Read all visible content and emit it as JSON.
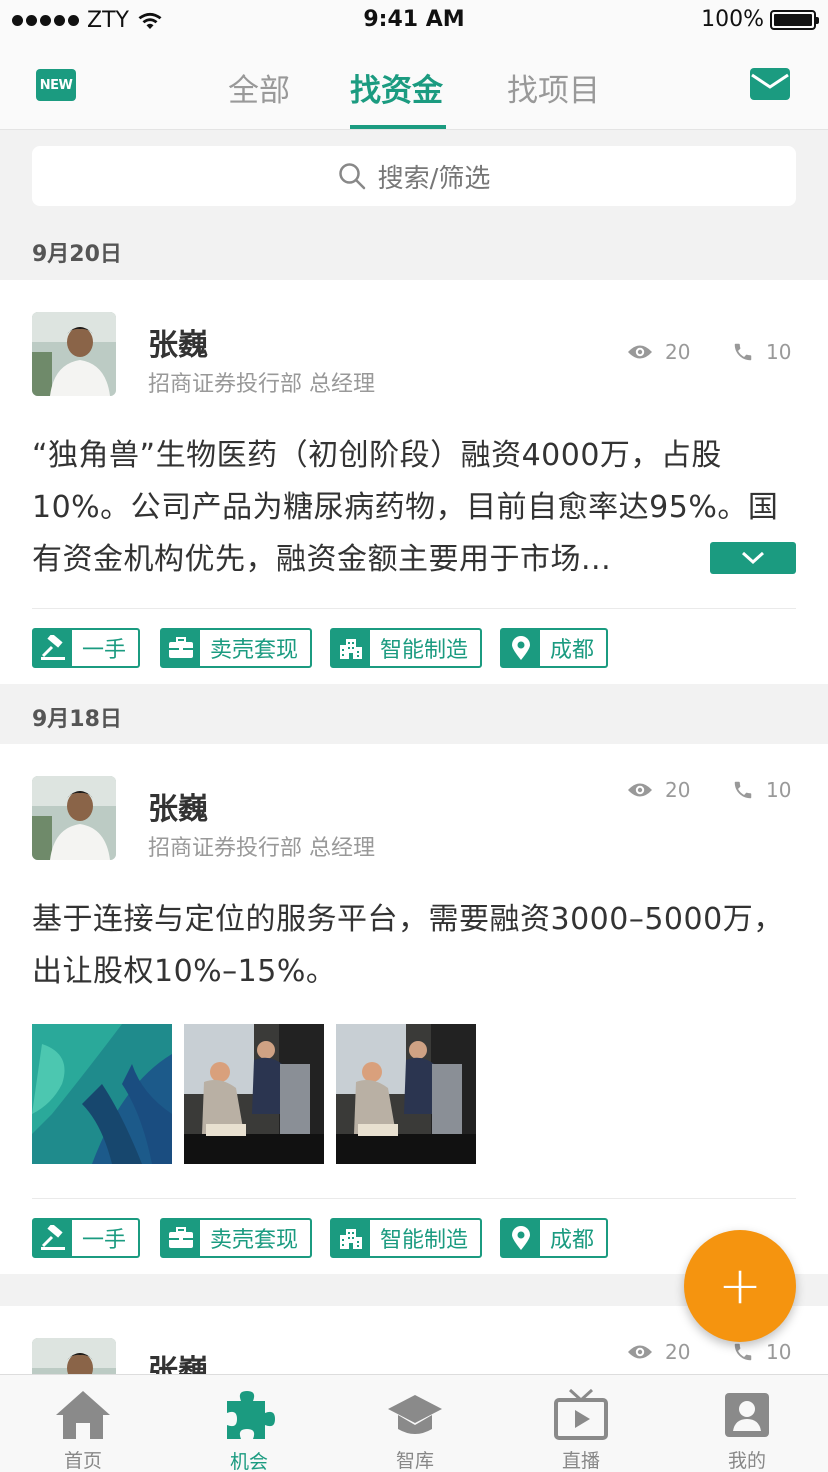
{
  "status_bar": {
    "carrier": "ZTY",
    "time": "9:41 AM",
    "battery": "100%"
  },
  "top_nav": {
    "new_badge": "NEW",
    "tabs": [
      {
        "label": "全部",
        "active": false
      },
      {
        "label": "找资金",
        "active": true
      },
      {
        "label": "找项目",
        "active": false
      }
    ],
    "mail_icon": "mail-icon"
  },
  "search": {
    "placeholder": "搜索/筛选"
  },
  "groups": [
    {
      "date": "9月20日",
      "post": {
        "name": "张巍",
        "subtitle": "招商证券投行部 总经理",
        "views": "20",
        "calls": "10",
        "text": "“独角兽”生物医药（初创阶段）融资4000万，占股10%。公司产品为糖尿病药物，目前自愈率达95%。国有资金机构优先，融资金额主要用于市场...",
        "tags": [
          "一手",
          "卖壳套现",
          "智能制造",
          "成都"
        ]
      }
    },
    {
      "date": "9月18日",
      "post": {
        "name": "张巍",
        "subtitle": "招商证券投行部 总经理",
        "views": "20",
        "calls": "10",
        "text": "基于连接与定位的服务平台，需要融资3000–5000万，出让股权10%–15%。",
        "tags": [
          "一手",
          "卖壳套现",
          "智能制造",
          "成都"
        ]
      }
    },
    {
      "date": "",
      "post": {
        "name": "张巍",
        "views": "20",
        "calls": "10"
      }
    }
  ],
  "fab": {
    "label": "+"
  },
  "bottom_nav": [
    {
      "label": "首页",
      "icon": "home-icon",
      "active": false
    },
    {
      "label": "机会",
      "icon": "puzzle-icon",
      "active": true
    },
    {
      "label": "智库",
      "icon": "graduation-cap-icon",
      "active": false
    },
    {
      "label": "直播",
      "icon": "tv-play-icon",
      "active": false
    },
    {
      "label": "我的",
      "icon": "user-icon",
      "active": false
    }
  ],
  "colors": {
    "accent": "#1b9b80",
    "fab": "#f5940f",
    "muted": "#999999"
  }
}
